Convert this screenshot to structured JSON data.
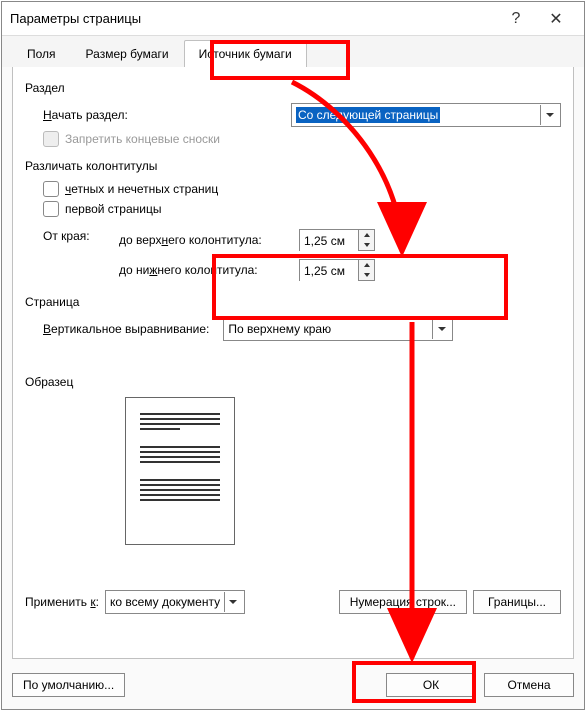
{
  "window": {
    "title": "Параметры страницы"
  },
  "tabs": {
    "fields": "Поля",
    "paper_size": "Размер бумаги",
    "paper_source": "Источник бумаги"
  },
  "section": {
    "label": "Раздел",
    "start_label_pre": "Н",
    "start_label_post": "ачать раздел:",
    "start_value": "Со следующей страницы",
    "suppress_endnotes": "Запретить концевые сноски"
  },
  "hf": {
    "label": "Различать колонтитулы",
    "odd_even_pre": "ч",
    "odd_even_post": "етных и нечетных страниц",
    "first_page": "первой страницы",
    "from_edge": "От края:",
    "header_pre": "до верх",
    "header_u": "н",
    "header_post": "его колонтитула:",
    "footer_pre": "до ни",
    "footer_u": "ж",
    "footer_post": "него колонтитула:",
    "header_val": "1,25 см",
    "footer_val": "1,25 см"
  },
  "page": {
    "label": "Страница",
    "valign_label_pre": "В",
    "valign_label_post": "ертикальное выравнивание:",
    "valign_value": "По верхнему краю"
  },
  "preview": {
    "label": "Образец"
  },
  "apply": {
    "label_pre": "Применить ",
    "label_u": "к",
    "label_post": ":",
    "value": "ко всему документу"
  },
  "buttons": {
    "line_numbers": "Нумерация строк...",
    "borders": "Границы...",
    "default": "По умолчанию...",
    "ok": "ОК",
    "cancel": "Отмена"
  }
}
